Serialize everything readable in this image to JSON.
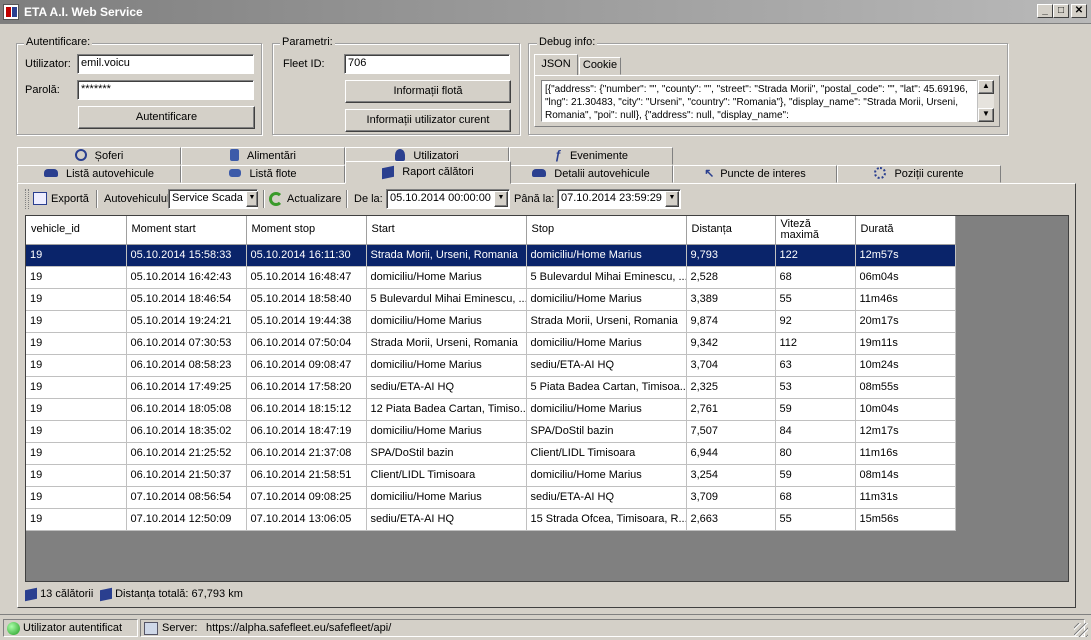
{
  "window": {
    "title": "ETA A.I. Web Service"
  },
  "auth": {
    "group": "Autentificare:",
    "user_label": "Utilizator:",
    "user_value": "emil.voicu",
    "pass_label": "Parolă:",
    "pass_value": "*******",
    "login_button": "Autentificare"
  },
  "params": {
    "group": "Parametri:",
    "fleet_label": "Fleet ID:",
    "fleet_value": "706",
    "fleet_info_button": "Informații flotă",
    "user_info_button": "Informații utilizator curent"
  },
  "debug": {
    "group": "Debug info:",
    "tab_json": "JSON",
    "tab_cookie": "Cookie",
    "text": "[{\"address\": {\"number\": \"\", \"county\": \"\", \"street\": \"Strada Morii\", \"postal_code\": \"\", \"lat\": 45.69196, \"lng\": 21.30483, \"city\": \"Urseni\", \"country\": \"Romania\"}, \"display_name\": \"Strada Morii, Urseni, Romania\", \"poi\": null}, {\"address\": null, \"display_name\":"
  },
  "tabs": {
    "row1": [
      "Șoferi",
      "Alimentări",
      "Utilizatori",
      "Evenimente"
    ],
    "row2": [
      "Listă autovehicule",
      "Listă flote",
      "Raport călători",
      "Detalii autovehicule",
      "Puncte de interes",
      "Poziții curente"
    ]
  },
  "toolbar": {
    "export": "Exportă",
    "vehicle_label": "Autovehiculul:",
    "vehicle_value": "Service Scada",
    "refresh": "Actualizare",
    "from_label": "De la:",
    "from_value": "05.10.2014 00:00:00",
    "to_label": "Până la:",
    "to_value": "07.10.2014 23:59:29"
  },
  "table": {
    "headers": [
      "vehicle_id",
      "Moment start",
      "Moment stop",
      "Start",
      "Stop",
      "Distanța",
      "Viteză maximă",
      "Durată"
    ],
    "rows": [
      [
        "19",
        "05.10.2014 15:58:33",
        "05.10.2014 16:11:30",
        "Strada Morii, Urseni, Romania",
        "domiciliu/Home Marius",
        "9,793",
        "122",
        "12m57s"
      ],
      [
        "19",
        "05.10.2014 16:42:43",
        "05.10.2014 16:48:47",
        "domiciliu/Home Marius",
        "5 Bulevardul Mihai Eminescu, ...",
        "2,528",
        "68",
        "06m04s"
      ],
      [
        "19",
        "05.10.2014 18:46:54",
        "05.10.2014 18:58:40",
        "5 Bulevardul Mihai Eminescu, ...",
        "domiciliu/Home Marius",
        "3,389",
        "55",
        "11m46s"
      ],
      [
        "19",
        "05.10.2014 19:24:21",
        "05.10.2014 19:44:38",
        "domiciliu/Home Marius",
        "Strada Morii, Urseni, Romania",
        "9,874",
        "92",
        "20m17s"
      ],
      [
        "19",
        "06.10.2014 07:30:53",
        "06.10.2014 07:50:04",
        "Strada Morii, Urseni, Romania",
        "domiciliu/Home Marius",
        "9,342",
        "112",
        "19m11s"
      ],
      [
        "19",
        "06.10.2014 08:58:23",
        "06.10.2014 09:08:47",
        "domiciliu/Home Marius",
        "sediu/ETA-AI HQ",
        "3,704",
        "63",
        "10m24s"
      ],
      [
        "19",
        "06.10.2014 17:49:25",
        "06.10.2014 17:58:20",
        "sediu/ETA-AI HQ",
        "5 Piata Badea Cartan, Timisoa...",
        "2,325",
        "53",
        "08m55s"
      ],
      [
        "19",
        "06.10.2014 18:05:08",
        "06.10.2014 18:15:12",
        "12 Piata Badea Cartan, Timiso...",
        "domiciliu/Home Marius",
        "2,761",
        "59",
        "10m04s"
      ],
      [
        "19",
        "06.10.2014 18:35:02",
        "06.10.2014 18:47:19",
        "domiciliu/Home Marius",
        "SPA/DoStil bazin",
        "7,507",
        "84",
        "12m17s"
      ],
      [
        "19",
        "06.10.2014 21:25:52",
        "06.10.2014 21:37:08",
        "SPA/DoStil bazin",
        "Client/LIDL Timisoara",
        "6,944",
        "80",
        "11m16s"
      ],
      [
        "19",
        "06.10.2014 21:50:37",
        "06.10.2014 21:58:51",
        "Client/LIDL Timisoara",
        "domiciliu/Home Marius",
        "3,254",
        "59",
        "08m14s"
      ],
      [
        "19",
        "07.10.2014 08:56:54",
        "07.10.2014 09:08:25",
        "domiciliu/Home Marius",
        "sediu/ETA-AI HQ",
        "3,709",
        "68",
        "11m31s"
      ],
      [
        "19",
        "07.10.2014 12:50:09",
        "07.10.2014 13:06:05",
        "sediu/ETA-AI HQ",
        "15 Strada Ofcea, Timisoara, R...",
        "2,663",
        "55",
        "15m56s"
      ]
    ]
  },
  "summary": {
    "trips": "13 călătorii",
    "total": "Distanța totală: 67,793 km"
  },
  "status": {
    "auth": "Utilizator autentificat",
    "server_label": "Server:",
    "server_url": "https://alpha.safefleet.eu/safefleet/api/"
  }
}
